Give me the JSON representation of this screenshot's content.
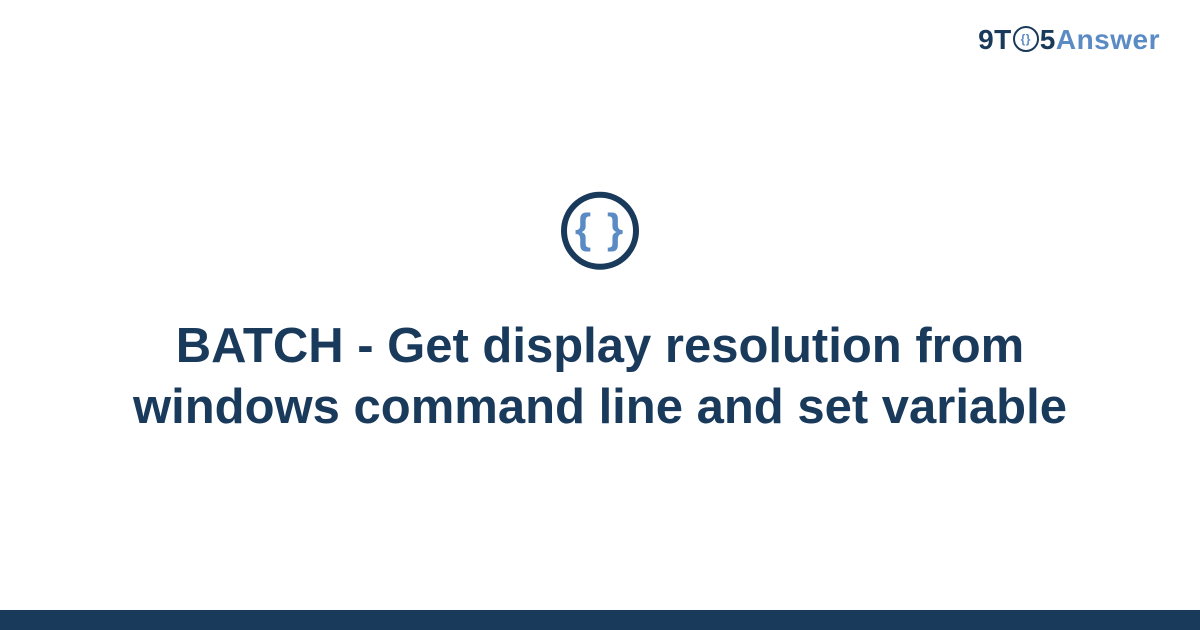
{
  "brand": {
    "part1": "9T",
    "circle_inner": "{}",
    "part2": "5",
    "part3": "Answer"
  },
  "icon": {
    "glyph": "{ }"
  },
  "title": "BATCH - Get display resolution from windows command line and set variable"
}
